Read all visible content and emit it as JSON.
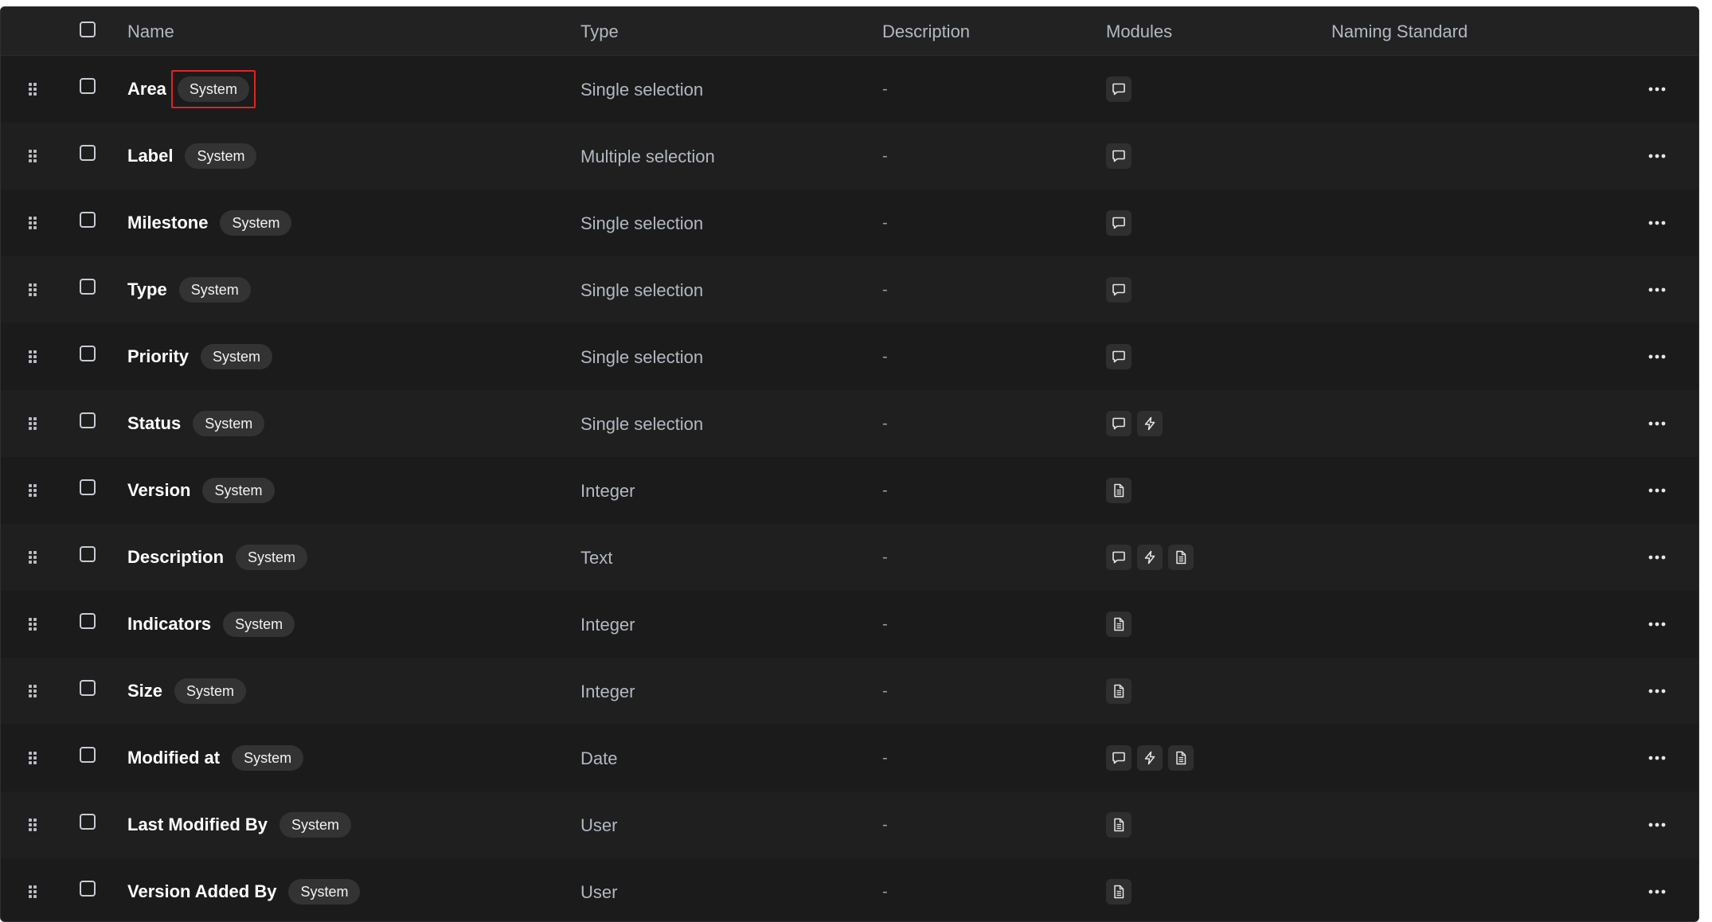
{
  "table": {
    "columns": {
      "name": "Name",
      "type": "Type",
      "description": "Description",
      "modules": "Modules",
      "naming_standard": "Naming Standard"
    },
    "rows": [
      {
        "name": "Area",
        "badge": "System",
        "type": "Single selection",
        "description": "-",
        "modules": [
          "comment-icon"
        ],
        "highlighted": true
      },
      {
        "name": "Label",
        "badge": "System",
        "type": "Multiple selection",
        "description": "-",
        "modules": [
          "comment-icon"
        ]
      },
      {
        "name": "Milestone",
        "badge": "System",
        "type": "Single selection",
        "description": "-",
        "modules": [
          "comment-icon"
        ]
      },
      {
        "name": "Type",
        "badge": "System",
        "type": "Single selection",
        "description": "-",
        "modules": [
          "comment-icon"
        ]
      },
      {
        "name": "Priority",
        "badge": "System",
        "type": "Single selection",
        "description": "-",
        "modules": [
          "comment-icon"
        ]
      },
      {
        "name": "Status",
        "badge": "System",
        "type": "Single selection",
        "description": "-",
        "modules": [
          "comment-icon",
          "lightning-icon"
        ]
      },
      {
        "name": "Version",
        "badge": "System",
        "type": "Integer",
        "description": "-",
        "modules": [
          "document-icon"
        ]
      },
      {
        "name": "Description",
        "badge": "System",
        "type": "Text",
        "description": "-",
        "modules": [
          "comment-icon",
          "lightning-icon",
          "document-icon"
        ]
      },
      {
        "name": "Indicators",
        "badge": "System",
        "type": "Integer",
        "description": "-",
        "modules": [
          "document-icon"
        ]
      },
      {
        "name": "Size",
        "badge": "System",
        "type": "Integer",
        "description": "-",
        "modules": [
          "document-icon"
        ]
      },
      {
        "name": "Modified at",
        "badge": "System",
        "type": "Date",
        "description": "-",
        "modules": [
          "comment-icon",
          "lightning-icon",
          "document-icon"
        ]
      },
      {
        "name": "Last Modified By",
        "badge": "System",
        "type": "User",
        "description": "-",
        "modules": [
          "document-icon"
        ]
      },
      {
        "name": "Version Added By",
        "badge": "System",
        "type": "User",
        "description": "-",
        "modules": [
          "document-icon"
        ]
      }
    ]
  },
  "colors": {
    "background": "#1c1c1c",
    "header": "#222222",
    "badge": "#333333",
    "highlight_box": "#e02424"
  }
}
